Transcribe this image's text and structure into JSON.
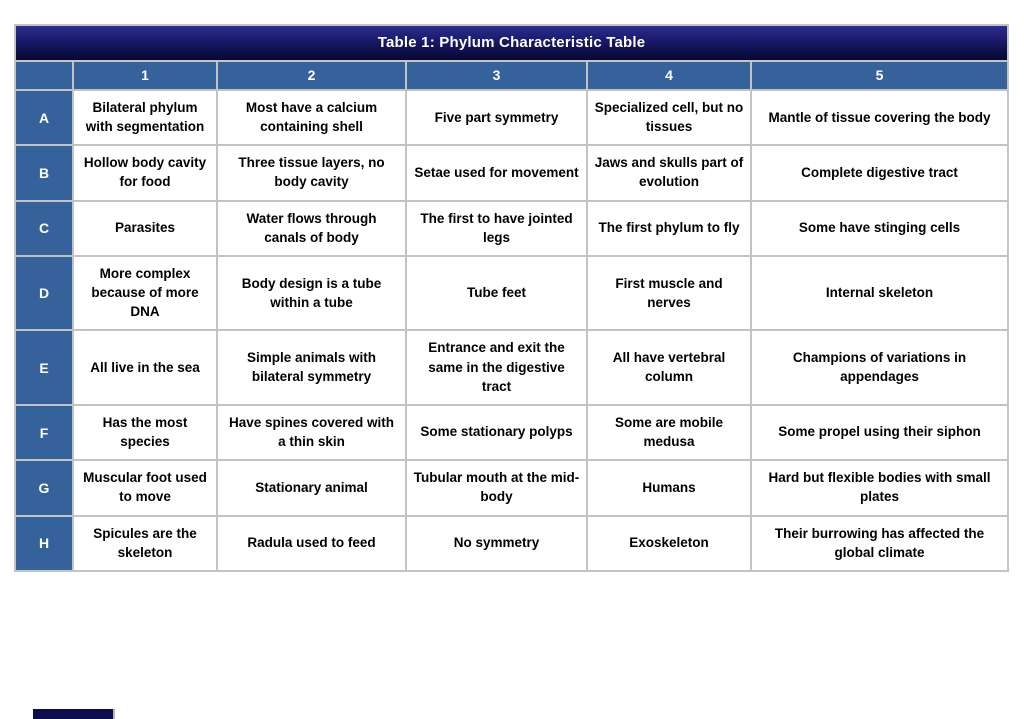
{
  "table": {
    "title": "Table 1: Phylum Characteristic Table",
    "column_headers": [
      "",
      "1",
      "2",
      "3",
      "4",
      "5"
    ],
    "row_labels": [
      "A",
      "B",
      "C",
      "D",
      "E",
      "F",
      "G",
      "H"
    ],
    "rows": [
      {
        "label": "A",
        "cells": [
          "Bilateral phylum with segmentation",
          "Most have a calcium containing shell",
          "Five part symmetry",
          "Specialized cell, but no tissues",
          "Mantle of tissue covering the body"
        ]
      },
      {
        "label": "B",
        "cells": [
          "Hollow body cavity for food",
          "Three tissue layers, no body cavity",
          "Setae used for movement",
          "Jaws and skulls part of evolution",
          "Complete digestive tract"
        ]
      },
      {
        "label": "C",
        "cells": [
          "Parasites",
          "Water flows through canals of body",
          "The first to have jointed legs",
          "The first phylum to fly",
          "Some have stinging cells"
        ]
      },
      {
        "label": "D",
        "cells": [
          "More complex because of more DNA",
          "Body design is a tube within a tube",
          "Tube feet",
          "First muscle and nerves",
          "Internal skeleton"
        ]
      },
      {
        "label": "E",
        "cells": [
          "All live in the sea",
          "Simple animals with bilateral symmetry",
          "Entrance and exit the same in the digestive tract",
          "All have vertebral column",
          "Champions of variations in appendages"
        ]
      },
      {
        "label": "F",
        "cells": [
          "Has the most species",
          "Have spines covered with a thin skin",
          "Some stationary polyps",
          "Some are mobile medusa",
          "Some propel using their siphon"
        ]
      },
      {
        "label": "G",
        "cells": [
          "Muscular foot used to move",
          "Stationary animal",
          "Tubular mouth at the mid-body",
          "Humans",
          "Hard but flexible bodies with small plates"
        ]
      },
      {
        "label": "H",
        "cells": [
          "Spicules are the skeleton",
          "Radula used to feed",
          "No symmetry",
          "Exoskeleton",
          "Their burrowing has affected the global climate"
        ]
      }
    ]
  },
  "colors": {
    "title_gradient_top": "#2d2d8f",
    "title_gradient_bottom": "#070733",
    "header_blue": "#36629b",
    "grid_gray": "#c3c3c3",
    "cell_background": "#ffffff",
    "cell_text": "#000000",
    "marker_navy": "#0d0d4e"
  }
}
